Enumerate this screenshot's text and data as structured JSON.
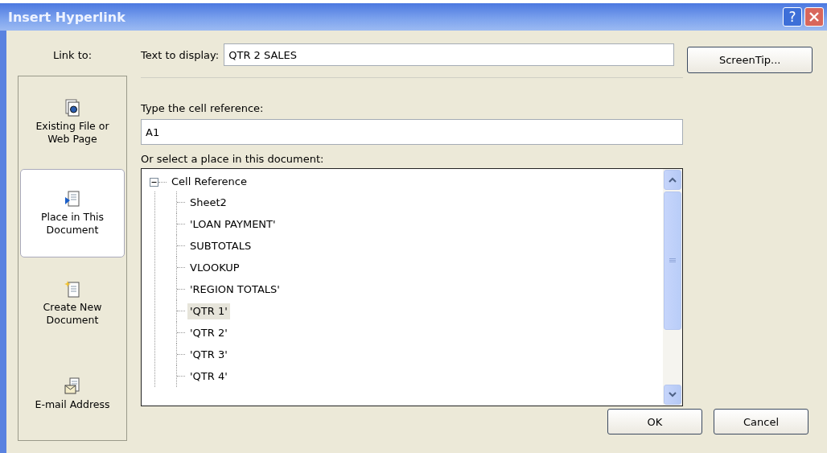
{
  "window": {
    "title": "Insert Hyperlink",
    "controls": [
      {
        "kind": "help",
        "label": "?"
      },
      {
        "kind": "close"
      }
    ]
  },
  "sidebar": {
    "label": "Link to:",
    "items": [
      {
        "label": "Existing File or\nWeb Page",
        "kind": "file",
        "selected": false
      },
      {
        "label": "Place in This\nDocument",
        "kind": "place",
        "selected": true
      },
      {
        "label": "Create New\nDocument",
        "kind": "new",
        "selected": false
      },
      {
        "label": "E-mail Address",
        "kind": "email",
        "selected": false
      }
    ]
  },
  "text_to_display": {
    "label": "Text to display:",
    "value": "QTR 2 SALES"
  },
  "screentip_button": "ScreenTip...",
  "cell_reference": {
    "label": "Type the cell reference:",
    "value": "A1"
  },
  "place_label": "Or select a place in this document:",
  "tree": {
    "label": "Cell Reference",
    "expanded": true,
    "children": [
      {
        "label": "Sheet2",
        "selected": false
      },
      {
        "label": "'LOAN PAYMENT'",
        "selected": false
      },
      {
        "label": "SUBTOTALS",
        "selected": false
      },
      {
        "label": "VLOOKUP",
        "selected": false
      },
      {
        "label": "'REGION TOTALS'",
        "selected": false
      },
      {
        "label": "'QTR 1'",
        "selected": true
      },
      {
        "label": "'QTR 2'",
        "selected": false
      },
      {
        "label": "'QTR 3'",
        "selected": false
      },
      {
        "label": "'QTR 4'",
        "selected": false
      }
    ]
  },
  "buttons": [
    "OK",
    "Cancel"
  ]
}
